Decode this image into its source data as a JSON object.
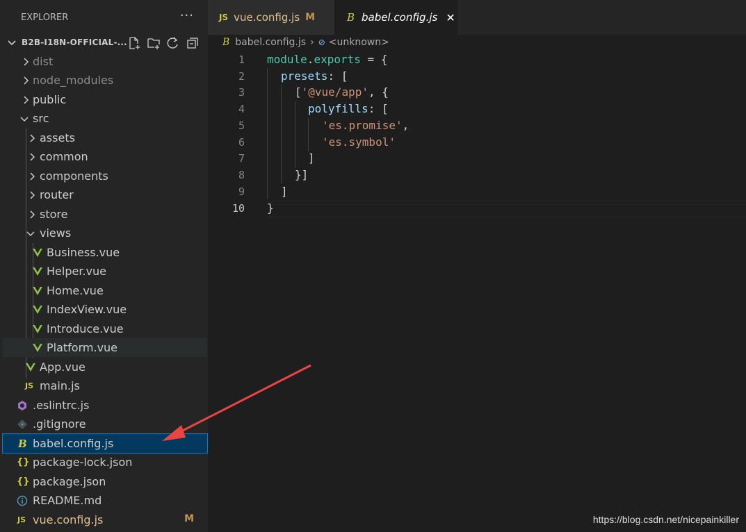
{
  "explorer": {
    "title": "EXPLORER",
    "more": "···",
    "project": "B2B-I18N-OFFICIAL-...",
    "items": [
      {
        "label": "dist",
        "type": "folder"
      },
      {
        "label": "node_modules",
        "type": "folder"
      },
      {
        "label": "public",
        "type": "folder"
      },
      {
        "label": "src",
        "type": "folder-open"
      },
      {
        "label": "assets",
        "type": "folder"
      },
      {
        "label": "common",
        "type": "folder"
      },
      {
        "label": "components",
        "type": "folder"
      },
      {
        "label": "router",
        "type": "folder"
      },
      {
        "label": "store",
        "type": "folder"
      },
      {
        "label": "views",
        "type": "folder-open"
      },
      {
        "label": "Business.vue",
        "type": "vue"
      },
      {
        "label": "Helper.vue",
        "type": "vue"
      },
      {
        "label": "Home.vue",
        "type": "vue"
      },
      {
        "label": "IndexView.vue",
        "type": "vue"
      },
      {
        "label": "Introduce.vue",
        "type": "vue"
      },
      {
        "label": "Platform.vue",
        "type": "vue"
      },
      {
        "label": "App.vue",
        "type": "vue"
      },
      {
        "label": "main.js",
        "type": "js"
      },
      {
        "label": ".eslintrc.js",
        "type": "eslint"
      },
      {
        "label": ".gitignore",
        "type": "git"
      },
      {
        "label": "babel.config.js",
        "type": "babel"
      },
      {
        "label": "package-lock.json",
        "type": "json"
      },
      {
        "label": "package.json",
        "type": "json"
      },
      {
        "label": "README.md",
        "type": "info"
      },
      {
        "label": "vue.config.js",
        "type": "js",
        "badge": "M"
      }
    ]
  },
  "tabs": [
    {
      "icon": "JS",
      "label": "vue.config.js",
      "badge": "M"
    },
    {
      "icon": "B",
      "label": "babel.config.js",
      "close": "✕"
    }
  ],
  "breadcrumb": {
    "file": "babel.config.js",
    "symbol": "<unknown>"
  },
  "code": {
    "line_numbers": [
      "1",
      "2",
      "3",
      "4",
      "5",
      "6",
      "7",
      "8",
      "9",
      "10"
    ],
    "l1a": "module",
    "l1b": ".",
    "l1c": "exports",
    "l1d": " = {",
    "l2a": "presets",
    "l2b": ": [",
    "l3a": "[",
    "l3b": "'@vue/app'",
    "l3c": ", {",
    "l4a": "polyfills",
    "l4b": ": [",
    "l5a": "'es.promise'",
    "l5b": ",",
    "l6a": "'es.symbol'",
    "l7": "]",
    "l8": "}]",
    "l9": "]",
    "l10": "}"
  },
  "colors": {
    "accent": "#007fd4",
    "selected": "#04395e",
    "vue": "#8dc149",
    "js": "#cbcb41",
    "annotation_arrow": "#e84545"
  },
  "watermark": "https://blog.csdn.net/nicepainkiller"
}
